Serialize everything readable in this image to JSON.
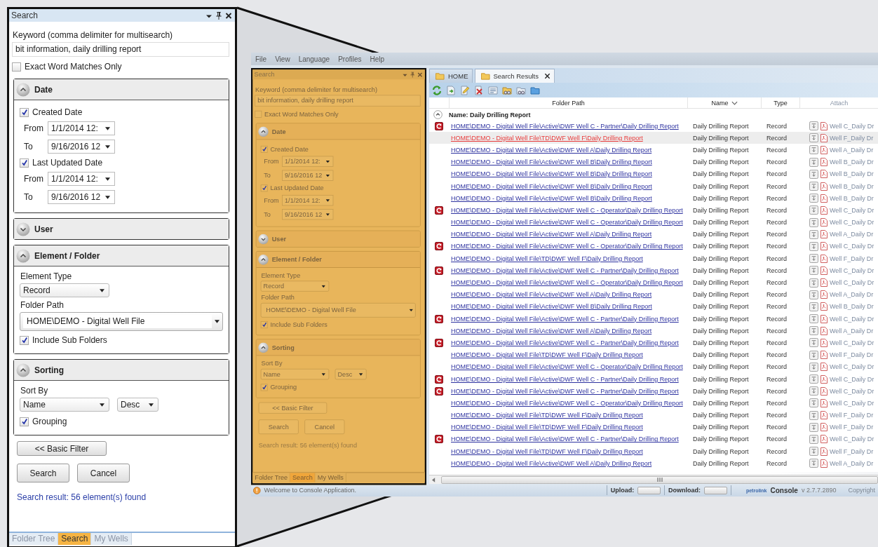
{
  "search_panel": {
    "title": "Search",
    "keyword": {
      "label": "Keyword (comma delimiter for multisearch)",
      "value": "bit information, daily drilling report"
    },
    "exact_match": {
      "label": "Exact Word Matches Only",
      "checked": false
    },
    "sections": [
      {
        "kind": "date",
        "title": "Date",
        "expanded": true,
        "filters": [
          {
            "label": "Created Date",
            "checked": true,
            "from_label": "From",
            "from": "1/1/2014 12:",
            "to_label": "To",
            "to": "9/16/2016 12"
          },
          {
            "label": "Last Updated Date",
            "checked": true,
            "from_label": "From",
            "from": "1/1/2014 12:",
            "to_label": "To",
            "to": "9/16/2016 12"
          }
        ]
      },
      {
        "kind": "user",
        "title": "User",
        "expanded": false
      },
      {
        "kind": "element",
        "title": "Element / Folder",
        "expanded": true,
        "element_type_label": "Element Type",
        "element_type": "Record",
        "folder_path_label": "Folder Path",
        "folder_path": "HOME\\DEMO - Digital Well File",
        "include_sub_folders": {
          "label": "Include Sub Folders",
          "checked": true
        }
      },
      {
        "kind": "sorting",
        "title": "Sorting",
        "expanded": true,
        "sort_by_label": "Sort By",
        "sort_field": "Name",
        "sort_order": "Desc",
        "grouping": {
          "label": "Grouping",
          "checked": true
        }
      }
    ],
    "basic_filter_button": "<< Basic Filter",
    "buttons": [
      "Search",
      "Cancel"
    ],
    "result": "Search result: 56 element(s) found",
    "tabs": [
      {
        "label": "Folder Tree",
        "selected": false
      },
      {
        "label": "Search",
        "selected": true
      },
      {
        "label": "My Wells",
        "selected": false
      }
    ]
  },
  "app": {
    "menu": [
      "File",
      "View",
      "Language",
      "Profiles",
      "Help"
    ],
    "search_panel": {
      "title": "Search",
      "keyword": {
        "label": "Keyword (comma delimiter for multisearch)",
        "value": "bit information, daily drilling report"
      },
      "exact_match": {
        "label": "Exact Word Matches Only",
        "checked": false
      },
      "sections": [
        {
          "kind": "date",
          "title": "Date",
          "expanded": true,
          "filters": [
            {
              "label": "Created Date",
              "checked": true,
              "from_label": "From",
              "from": "1/1/2014 12:",
              "to_label": "To",
              "to": "9/16/2016 12"
            },
            {
              "label": "Last Updated Date",
              "checked": true,
              "from_label": "From",
              "from": "1/1/2014 12:",
              "to_label": "To",
              "to": "9/16/2016 12"
            }
          ]
        },
        {
          "kind": "user",
          "title": "User",
          "expanded": false
        },
        {
          "kind": "element",
          "title": "Element / Folder",
          "expanded": true,
          "element_type_label": "Element Type",
          "element_type": "Record",
          "folder_path_label": "Folder Path",
          "folder_path": "HOME\\DEMO - Digital Well File",
          "include_sub_folders": {
            "label": "Include Sub Folders",
            "checked": true
          }
        },
        {
          "kind": "sorting",
          "title": "Sorting",
          "expanded": true,
          "sort_by_label": "Sort By",
          "sort_field": "Name",
          "sort_order": "Desc",
          "grouping": {
            "label": "Grouping",
            "checked": true
          }
        }
      ],
      "basic_filter_button": "<< Basic Filter",
      "buttons": [
        "Search",
        "Cancel"
      ],
      "result": "Search result: 56 element(s) found",
      "tabs": [
        {
          "label": "Folder Tree",
          "selected": false
        },
        {
          "label": "Search",
          "selected": true
        },
        {
          "label": "My Wells",
          "selected": false
        }
      ]
    },
    "tabs": [
      {
        "label": "HOME",
        "selected": false,
        "closable": false
      },
      {
        "label": "Search Results",
        "selected": true,
        "closable": true
      }
    ],
    "table": {
      "columns": [
        "Folder Path",
        "Name",
        "Type",
        "Attach"
      ],
      "group": "Name: Daily Drilling Report",
      "group_expanded": true,
      "rows": [
        {
          "icon": true,
          "path": "HOME\\DEMO - Digital Well File\\Active\\DWF Well C - Partner\\Daily Drilling Report",
          "name": "Daily Drilling Report",
          "type": "Record",
          "attachment": "Well C_Daily Dr",
          "selected": false
        },
        {
          "icon": false,
          "path": "HOME\\DEMO - Digital Well File\\TD\\DWF Well F\\Daily Drilling Report",
          "name": "Daily Drilling Report",
          "type": "Record",
          "attachment": "Well F_Daily Dr",
          "selected": true
        },
        {
          "icon": false,
          "path": "HOME\\DEMO - Digital Well File\\Active\\DWF Well A\\Daily Drilling Report",
          "name": "Daily Drilling Report",
          "type": "Record",
          "attachment": "Well A_Daily Dr",
          "selected": false
        },
        {
          "icon": false,
          "path": "HOME\\DEMO - Digital Well File\\Active\\DWF Well B\\Daily Drilling Report",
          "name": "Daily Drilling Report",
          "type": "Record",
          "attachment": "Well B_Daily Dr",
          "selected": false
        },
        {
          "icon": false,
          "path": "HOME\\DEMO - Digital Well File\\Active\\DWF Well B\\Daily Drilling Report",
          "name": "Daily Drilling Report",
          "type": "Record",
          "attachment": "Well B_Daily Dr",
          "selected": false
        },
        {
          "icon": false,
          "path": "HOME\\DEMO - Digital Well File\\Active\\DWF Well B\\Daily Drilling Report",
          "name": "Daily Drilling Report",
          "type": "Record",
          "attachment": "Well B_Daily Dr",
          "selected": false
        },
        {
          "icon": false,
          "path": "HOME\\DEMO - Digital Well File\\Active\\DWF Well B\\Daily Drilling Report",
          "name": "Daily Drilling Report",
          "type": "Record",
          "attachment": "Well B_Daily Dr",
          "selected": false
        },
        {
          "icon": true,
          "path": "HOME\\DEMO - Digital Well File\\Active\\DWF Well C - Operator\\Daily Drilling Report",
          "name": "Daily Drilling Report",
          "type": "Record",
          "attachment": "Well C_Daily Dr",
          "selected": false
        },
        {
          "icon": false,
          "path": "HOME\\DEMO - Digital Well File\\Active\\DWF Well C - Operator\\Daily Drilling Report",
          "name": "Daily Drilling Report",
          "type": "Record",
          "attachment": "Well C_Daily Dr",
          "selected": false
        },
        {
          "icon": false,
          "path": "HOME\\DEMO - Digital Well File\\Active\\DWF Well A\\Daily Drilling Report",
          "name": "Daily Drilling Report",
          "type": "Record",
          "attachment": "Well A_Daily Dr",
          "selected": false
        },
        {
          "icon": true,
          "path": "HOME\\DEMO - Digital Well File\\Active\\DWF Well C - Operator\\Daily Drilling Report",
          "name": "Daily Drilling Report",
          "type": "Record",
          "attachment": "Well C_Daily Dr",
          "selected": false
        },
        {
          "icon": false,
          "path": "HOME\\DEMO - Digital Well File\\TD\\DWF Well F\\Daily Drilling Report",
          "name": "Daily Drilling Report",
          "type": "Record",
          "attachment": "Well F_Daily Dr",
          "selected": false
        },
        {
          "icon": true,
          "path": "HOME\\DEMO - Digital Well File\\Active\\DWF Well C - Partner\\Daily Drilling Report",
          "name": "Daily Drilling Report",
          "type": "Record",
          "attachment": "Well C_Daily Dr",
          "selected": false
        },
        {
          "icon": false,
          "path": "HOME\\DEMO - Digital Well File\\Active\\DWF Well C - Operator\\Daily Drilling Report",
          "name": "Daily Drilling Report",
          "type": "Record",
          "attachment": "Well C_Daily Dr",
          "selected": false
        },
        {
          "icon": false,
          "path": "HOME\\DEMO - Digital Well File\\Active\\DWF Well A\\Daily Drilling Report",
          "name": "Daily Drilling Report",
          "type": "Record",
          "attachment": "Well A_Daily Dr",
          "selected": false
        },
        {
          "icon": false,
          "path": "HOME\\DEMO - Digital Well File\\Active\\DWF Well B\\Daily Drilling Report",
          "name": "Daily Drilling Report",
          "type": "Record",
          "attachment": "Well B_Daily Dr",
          "selected": false
        },
        {
          "icon": true,
          "path": "HOME\\DEMO - Digital Well File\\Active\\DWF Well C - Partner\\Daily Drilling Report",
          "name": "Daily Drilling Report",
          "type": "Record",
          "attachment": "Well C_Daily Dr",
          "selected": false
        },
        {
          "icon": false,
          "path": "HOME\\DEMO - Digital Well File\\Active\\DWF Well A\\Daily Drilling Report",
          "name": "Daily Drilling Report",
          "type": "Record",
          "attachment": "Well A_Daily Dr",
          "selected": false
        },
        {
          "icon": true,
          "path": "HOME\\DEMO - Digital Well File\\Active\\DWF Well C - Partner\\Daily Drilling Report",
          "name": "Daily Drilling Report",
          "type": "Record",
          "attachment": "Well C_Daily Dr",
          "selected": false
        },
        {
          "icon": false,
          "path": "HOME\\DEMO - Digital Well File\\TD\\DWF Well F\\Daily Drilling Report",
          "name": "Daily Drilling Report",
          "type": "Record",
          "attachment": "Well F_Daily Dr",
          "selected": false
        },
        {
          "icon": false,
          "path": "HOME\\DEMO - Digital Well File\\Active\\DWF Well C - Operator\\Daily Drilling Report",
          "name": "Daily Drilling Report",
          "type": "Record",
          "attachment": "Well C_Daily Dr",
          "selected": false
        },
        {
          "icon": true,
          "path": "HOME\\DEMO - Digital Well File\\Active\\DWF Well C - Partner\\Daily Drilling Report",
          "name": "Daily Drilling Report",
          "type": "Record",
          "attachment": "Well C_Daily Dr",
          "selected": false
        },
        {
          "icon": true,
          "path": "HOME\\DEMO - Digital Well File\\Active\\DWF Well C - Partner\\Daily Drilling Report",
          "name": "Daily Drilling Report",
          "type": "Record",
          "attachment": "Well C_Daily Dr",
          "selected": false
        },
        {
          "icon": false,
          "path": "HOME\\DEMO - Digital Well File\\Active\\DWF Well C - Operator\\Daily Drilling Report",
          "name": "Daily Drilling Report",
          "type": "Record",
          "attachment": "Well C_Daily Dr",
          "selected": false
        },
        {
          "icon": false,
          "path": "HOME\\DEMO - Digital Well File\\TD\\DWF Well F\\Daily Drilling Report",
          "name": "Daily Drilling Report",
          "type": "Record",
          "attachment": "Well F_Daily Dr",
          "selected": false
        },
        {
          "icon": false,
          "path": "HOME\\DEMO - Digital Well File\\TD\\DWF Well F\\Daily Drilling Report",
          "name": "Daily Drilling Report",
          "type": "Record",
          "attachment": "Well F_Daily Dr",
          "selected": false
        },
        {
          "icon": true,
          "path": "HOME\\DEMO - Digital Well File\\Active\\DWF Well C - Partner\\Daily Drilling Report",
          "name": "Daily Drilling Report",
          "type": "Record",
          "attachment": "Well C_Daily Dr",
          "selected": false
        },
        {
          "icon": false,
          "path": "HOME\\DEMO - Digital Well File\\TD\\DWF Well F\\Daily Drilling Report",
          "name": "Daily Drilling Report",
          "type": "Record",
          "attachment": "Well F_Daily Dr",
          "selected": false
        },
        {
          "icon": false,
          "path": "HOME\\DEMO - Digital Well File\\Active\\DWF Well A\\Daily Drilling Report",
          "name": "Daily Drilling Report",
          "type": "Record",
          "attachment": "Well A_Daily Dr",
          "selected": false
        }
      ]
    },
    "status_bar": {
      "message": "Welcome to Console Application.",
      "upload": {
        "label": "Upload:",
        "level": 0
      },
      "download": {
        "label": "Download:",
        "level": 0
      },
      "logo": "petrolink",
      "product": "Console",
      "version": "v 2.7.7.2890",
      "copyright": "Copyright"
    }
  }
}
